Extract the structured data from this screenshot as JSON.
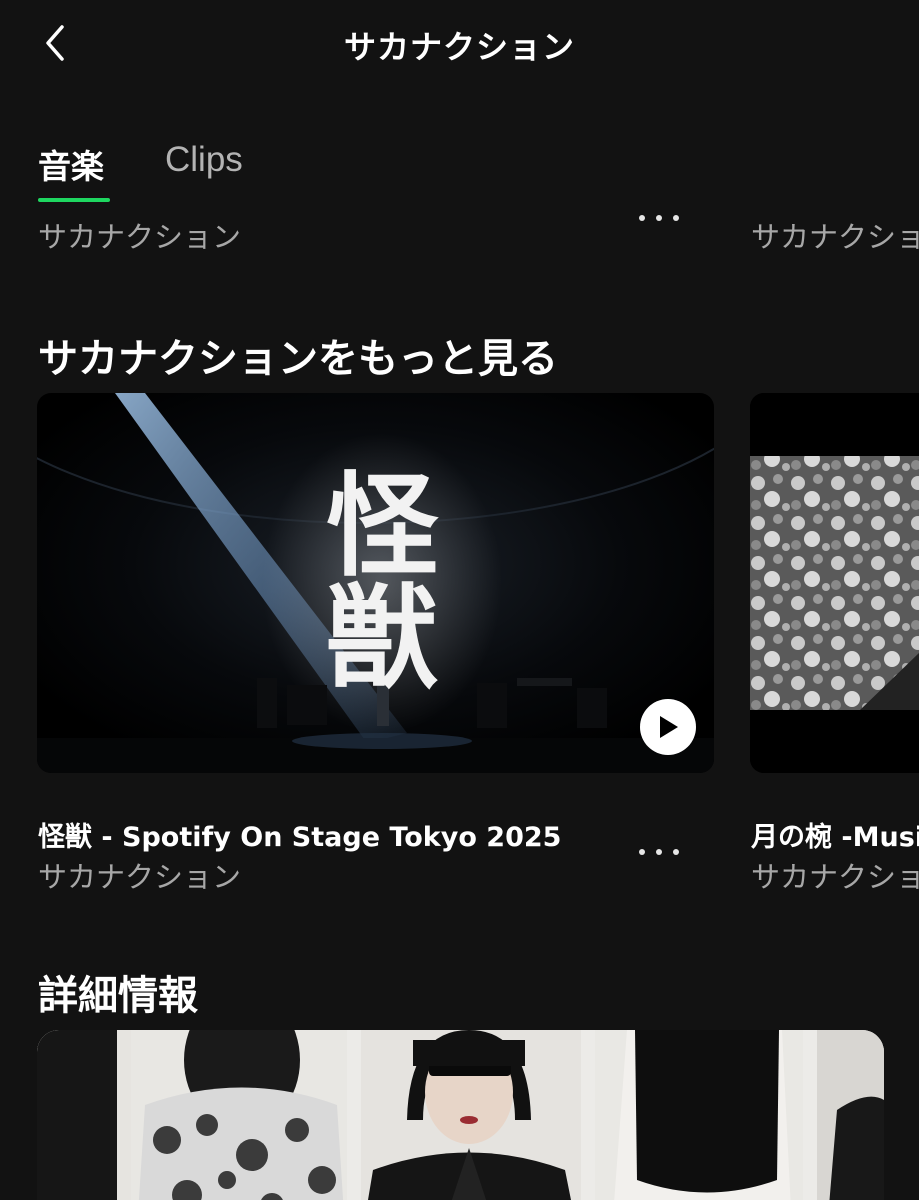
{
  "header": {
    "title": "サカナクション",
    "back_icon": "chevron-left-icon"
  },
  "tabs": [
    {
      "label": "音楽",
      "active": true
    },
    {
      "label": "Clips",
      "active": false
    }
  ],
  "above_row": [
    {
      "artist": "サカナクション"
    },
    {
      "artist": "サカナクショ"
    }
  ],
  "more_section": {
    "title": "サカナクションをもっと見る",
    "videos": [
      {
        "title": "怪獣 - Spotify On Stage Tokyo 2025",
        "artist": "サカナクション",
        "thumbnail_text_1": "怪",
        "thumbnail_text_2": "獣",
        "play_icon": "play-icon"
      },
      {
        "title": "月の椀 -Musi",
        "artist": "サカナクショ"
      }
    ]
  },
  "about_section": {
    "title": "詳細情報"
  },
  "colors": {
    "background": "#121212",
    "accent": "#1ed760",
    "secondary_text": "#a7a7a7"
  }
}
